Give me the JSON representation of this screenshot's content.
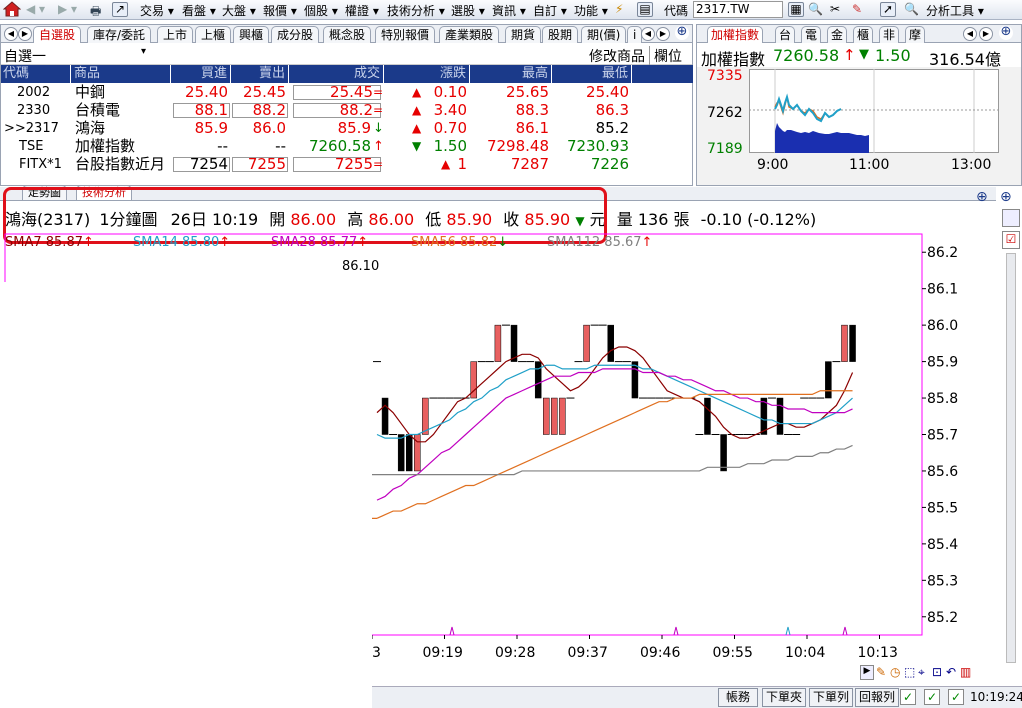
{
  "toolbar": {
    "menus": [
      "交易",
      "看盤",
      "大盤",
      "報價",
      "個股",
      "權證",
      "技術分析",
      "選股",
      "資訊",
      "自訂",
      "功能"
    ],
    "code_label": "代碼",
    "code_value": "2317.TW",
    "tools_label": "分析工具"
  },
  "watch_tabs": [
    "自選股",
    "庫存/委託",
    "上市",
    "上櫃",
    "興櫃",
    "成分股",
    "概念股",
    "特別報價",
    "產業類股",
    "期貨",
    "股期",
    "期(價)",
    "i"
  ],
  "watch": {
    "group": "自選一",
    "edit": "修改商品",
    "columns_btn": "欄位",
    "headers": [
      "代碼",
      "商品",
      "買進",
      "賣出",
      "成交",
      "漲跌",
      "最高",
      "最低"
    ],
    "rows": [
      {
        "code": "2002",
        "name": "中鋼",
        "bid": "25.40",
        "ask": "25.45",
        "last": "25.45",
        "chg": "0.10",
        "high": "25.65",
        "low": "25.40"
      },
      {
        "code": "2330",
        "name": "台積電",
        "bid": "88.1",
        "ask": "88.2",
        "last": "88.2",
        "chg": "3.40",
        "high": "88.3",
        "low": "86.3"
      },
      {
        "code": ">>2317",
        "name": "鴻海",
        "bid": "85.9",
        "ask": "86.0",
        "last": "85.9",
        "chg": "0.70",
        "high": "86.1",
        "low": "85.2"
      },
      {
        "code": "TSE",
        "name": "加權指數",
        "bid": "--",
        "ask": "--",
        "last": "7260.58",
        "chg": "1.50",
        "high": "7298.48",
        "low": "7230.93"
      },
      {
        "code": "FITX*1",
        "name": "台股指數近月",
        "bid": "7254",
        "ask": "7255",
        "last": "7255",
        "chg": "1",
        "high": "7287",
        "low": "7226"
      }
    ]
  },
  "index_tabs": [
    "加權指數",
    "台",
    "電",
    "金",
    "櫃",
    "非",
    "摩"
  ],
  "index": {
    "name": "加權指數",
    "value": "7260.58",
    "change": "1.50",
    "volume": "316.54億",
    "y_labels": [
      "7335",
      "7262",
      "7189"
    ],
    "x_labels": [
      "9:00",
      "11:00",
      "13:00"
    ]
  },
  "chart_tabs": [
    "走勢圖",
    "技術分析"
  ],
  "info": {
    "stock": "鴻海(2317)",
    "period": "1分鐘圖",
    "date": "26日 10:19",
    "open_label": "開",
    "open": "86.00",
    "high_label": "高",
    "high": "86.00",
    "low_label": "低",
    "low": "85.90",
    "close_label": "收",
    "close": "85.90",
    "unit": "元",
    "vol_label": "量",
    "vol": "136",
    "vol_unit": "張",
    "change": "-0.10 (-0.12%)"
  },
  "ma_labels": [
    "SMA7 85.87",
    "SMA14 85.80",
    "SMA28 85.77",
    "SMA56 85.82",
    "SMA112 85.67"
  ],
  "peak_label": "86.10",
  "chart_data": {
    "type": "candlestick",
    "y_ticks": [
      "86.2",
      "86.1",
      "86.0",
      "85.9",
      "85.8",
      "85.7",
      "85.6",
      "85.5",
      "85.4",
      "85.3",
      "85.2"
    ],
    "ylim": [
      85.15,
      86.25
    ],
    "x_ticks": [
      "3",
      "09:19",
      "09:28",
      "09:37",
      "09:46",
      "09:55",
      "10:04",
      "10:13"
    ],
    "visible_from_minute": 14,
    "candles": [
      [
        85.9,
        86.0,
        86.0,
        85.9
      ],
      [
        85.8,
        85.8,
        85.8,
        85.7
      ],
      [
        85.7,
        85.7,
        85.7,
        85.7
      ],
      [
        85.7,
        85.7,
        85.6,
        85.6
      ],
      [
        85.7,
        85.7,
        85.6,
        85.6
      ],
      [
        85.6,
        85.7,
        85.6,
        85.7
      ],
      [
        85.7,
        85.8,
        85.7,
        85.8
      ],
      [
        85.8,
        85.8,
        85.8,
        85.8
      ],
      [
        85.8,
        85.8,
        85.8,
        85.8
      ],
      [
        85.8,
        85.8,
        85.8,
        85.8
      ],
      [
        85.8,
        85.8,
        85.8,
        85.8
      ],
      [
        85.8,
        85.8,
        85.8,
        85.8
      ],
      [
        85.8,
        85.9,
        85.8,
        85.9
      ],
      [
        85.9,
        85.9,
        85.9,
        85.9
      ],
      [
        85.9,
        85.9,
        85.9,
        85.9
      ],
      [
        85.9,
        86.0,
        85.9,
        86.0
      ],
      [
        86.0,
        86.0,
        86.0,
        86.0
      ],
      [
        86.0,
        86.0,
        85.9,
        85.9
      ],
      [
        85.9,
        85.9,
        85.9,
        85.9
      ],
      [
        85.9,
        85.9,
        85.9,
        85.9
      ],
      [
        85.9,
        85.9,
        85.8,
        85.8
      ],
      [
        85.7,
        85.8,
        85.7,
        85.8
      ],
      [
        85.7,
        85.8,
        85.7,
        85.8
      ],
      [
        85.7,
        85.8,
        85.7,
        85.8
      ],
      [
        85.8,
        85.8,
        85.8,
        85.8
      ],
      [
        85.9,
        85.9,
        85.9,
        85.9
      ],
      [
        85.9,
        86.0,
        85.9,
        86.0
      ],
      [
        86.0,
        86.0,
        86.0,
        86.0
      ],
      [
        86.0,
        86.0,
        86.0,
        86.0
      ],
      [
        86.0,
        86.0,
        85.9,
        85.9
      ],
      [
        85.9,
        85.9,
        85.9,
        85.9
      ],
      [
        85.9,
        85.9,
        85.9,
        85.9
      ],
      [
        85.9,
        85.9,
        85.8,
        85.8
      ],
      [
        85.8,
        85.8,
        85.8,
        85.8
      ],
      [
        85.8,
        85.8,
        85.8,
        85.8
      ],
      [
        85.8,
        85.8,
        85.8,
        85.8
      ],
      [
        85.8,
        85.8,
        85.8,
        85.8
      ],
      [
        85.8,
        85.8,
        85.8,
        85.8
      ],
      [
        85.8,
        85.8,
        85.8,
        85.8
      ],
      [
        85.8,
        85.8,
        85.8,
        85.8
      ],
      [
        85.7,
        85.7,
        85.7,
        85.7
      ],
      [
        85.8,
        85.8,
        85.7,
        85.7
      ],
      [
        85.7,
        85.7,
        85.7,
        85.7
      ],
      [
        85.7,
        85.7,
        85.6,
        85.6
      ],
      [
        85.7,
        85.7,
        85.7,
        85.7
      ],
      [
        85.7,
        85.7,
        85.7,
        85.7
      ],
      [
        85.7,
        85.7,
        85.7,
        85.7
      ],
      [
        85.7,
        85.7,
        85.7,
        85.7
      ],
      [
        85.8,
        85.8,
        85.7,
        85.7
      ],
      [
        85.8,
        85.8,
        85.8,
        85.8
      ],
      [
        85.8,
        85.8,
        85.7,
        85.7
      ],
      [
        85.7,
        85.7,
        85.7,
        85.7
      ],
      [
        85.7,
        85.7,
        85.7,
        85.7
      ],
      [
        85.8,
        85.8,
        85.8,
        85.8
      ],
      [
        85.8,
        85.8,
        85.8,
        85.8
      ],
      [
        85.8,
        85.8,
        85.8,
        85.8
      ],
      [
        85.9,
        85.9,
        85.8,
        85.8
      ],
      [
        85.9,
        85.9,
        85.9,
        85.9
      ],
      [
        85.9,
        86.0,
        85.9,
        86.0
      ],
      [
        86.0,
        86.0,
        85.9,
        85.9
      ]
    ],
    "series": [
      {
        "name": "SMA7",
        "color": "#8b0000",
        "values": [
          85.76,
          85.78,
          85.76,
          85.73,
          85.7,
          85.68,
          85.68,
          85.7,
          85.73,
          85.76,
          85.79,
          85.8,
          85.82,
          85.84,
          85.86,
          85.88,
          85.9,
          85.91,
          85.92,
          85.92,
          85.91,
          85.88,
          85.86,
          85.84,
          85.82,
          85.83,
          85.85,
          85.88,
          85.91,
          85.93,
          85.94,
          85.94,
          85.93,
          85.91,
          85.88,
          85.85,
          85.82,
          85.81,
          85.8,
          85.8,
          85.79,
          85.77,
          85.75,
          85.72,
          85.7,
          85.69,
          85.69,
          85.7,
          85.71,
          85.72,
          85.73,
          85.73,
          85.72,
          85.72,
          85.73,
          85.74,
          85.76,
          85.78,
          85.82,
          85.87
        ]
      },
      {
        "name": "SMA14",
        "color": "#20a0c8",
        "values": [
          85.7,
          85.69,
          85.69,
          85.69,
          85.7,
          85.7,
          85.71,
          85.72,
          85.73,
          85.74,
          85.76,
          85.77,
          85.79,
          85.8,
          85.82,
          85.83,
          85.85,
          85.86,
          85.87,
          85.88,
          85.88,
          85.89,
          85.89,
          85.88,
          85.88,
          85.88,
          85.88,
          85.89,
          85.89,
          85.89,
          85.89,
          85.89,
          85.89,
          85.88,
          85.88,
          85.87,
          85.86,
          85.85,
          85.84,
          85.83,
          85.82,
          85.81,
          85.8,
          85.79,
          85.78,
          85.77,
          85.76,
          85.75,
          85.74,
          85.74,
          85.73,
          85.73,
          85.73,
          85.73,
          85.73,
          85.74,
          85.75,
          85.76,
          85.78,
          85.8
        ]
      },
      {
        "name": "SMA28",
        "color": "#c000c0",
        "values": [
          85.52,
          85.53,
          85.55,
          85.56,
          85.58,
          85.59,
          85.61,
          85.63,
          85.65,
          85.66,
          85.68,
          85.7,
          85.72,
          85.74,
          85.76,
          85.78,
          85.8,
          85.81,
          85.82,
          85.83,
          85.84,
          85.85,
          85.86,
          85.86,
          85.86,
          85.87,
          85.87,
          85.87,
          85.88,
          85.88,
          85.88,
          85.88,
          85.88,
          85.87,
          85.87,
          85.87,
          85.86,
          85.86,
          85.85,
          85.85,
          85.84,
          85.83,
          85.82,
          85.82,
          85.81,
          85.8,
          85.8,
          85.79,
          85.79,
          85.78,
          85.78,
          85.77,
          85.77,
          85.77,
          85.76,
          85.76,
          85.76,
          85.76,
          85.76,
          85.77
        ]
      },
      {
        "name": "SMA56",
        "color": "#e07020",
        "values": [
          85.47,
          85.48,
          85.49,
          85.49,
          85.5,
          85.51,
          85.51,
          85.52,
          85.53,
          85.54,
          85.55,
          85.56,
          85.56,
          85.57,
          85.58,
          85.59,
          85.6,
          85.61,
          85.62,
          85.63,
          85.64,
          85.65,
          85.66,
          85.67,
          85.68,
          85.69,
          85.7,
          85.71,
          85.72,
          85.73,
          85.74,
          85.75,
          85.76,
          85.77,
          85.78,
          85.79,
          85.79,
          85.8,
          85.8,
          85.8,
          85.81,
          85.81,
          85.81,
          85.81,
          85.81,
          85.81,
          85.81,
          85.81,
          85.81,
          85.81,
          85.81,
          85.81,
          85.81,
          85.81,
          85.81,
          85.82,
          85.82,
          85.82,
          85.82,
          85.82
        ]
      },
      {
        "name": "SMA112",
        "color": "#808080",
        "values": [
          85.59,
          85.59,
          85.59,
          85.59,
          85.59,
          85.59,
          85.59,
          85.59,
          85.59,
          85.59,
          85.59,
          85.59,
          85.59,
          85.59,
          85.59,
          85.59,
          85.59,
          85.59,
          85.6,
          85.6,
          85.6,
          85.6,
          85.6,
          85.6,
          85.6,
          85.6,
          85.6,
          85.6,
          85.6,
          85.6,
          85.6,
          85.6,
          85.6,
          85.6,
          85.6,
          85.6,
          85.6,
          85.6,
          85.6,
          85.6,
          85.6,
          85.61,
          85.61,
          85.61,
          85.61,
          85.61,
          85.62,
          85.62,
          85.62,
          85.63,
          85.63,
          85.63,
          85.64,
          85.64,
          85.64,
          85.65,
          85.65,
          85.66,
          85.66,
          85.67
        ]
      }
    ]
  },
  "status": {
    "buttons": [
      "帳務",
      "下單夾",
      "下單列",
      "回報列"
    ],
    "time": "10:19:24"
  },
  "colors": {
    "up": "#e60000",
    "down": "#008000",
    "header_bg": "#1b3a8a",
    "chart_frame": "#ff00ff",
    "highlight": "#e0101a"
  }
}
